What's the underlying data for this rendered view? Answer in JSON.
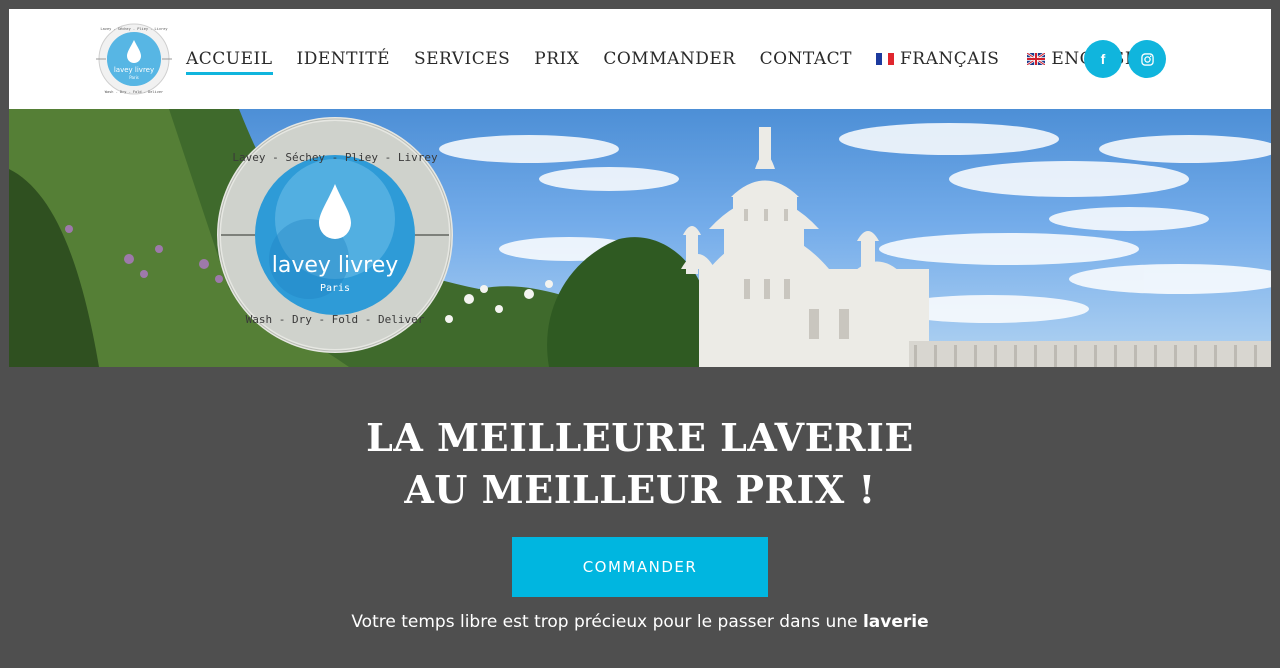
{
  "brand": {
    "logo_ring_top": "Lavey - Séchey - Pliey - Livrey",
    "logo_ring_bottom": "Wash - Dry - Fold - Deliver",
    "logo_name": "lavey livrey",
    "logo_city": "Paris"
  },
  "nav": {
    "items": [
      {
        "label": "ACCUEIL",
        "active": true
      },
      {
        "label": "IDENTITÉ"
      },
      {
        "label": "SERVICES"
      },
      {
        "label": "PRIX"
      },
      {
        "label": "COMMANDER"
      },
      {
        "label": "CONTACT"
      }
    ],
    "lang_fr": "FRANÇAIS",
    "lang_en": "ENGLISH"
  },
  "social": {
    "facebook_glyph": "f",
    "instagram_icon": "instagram-icon",
    "accent": "#10b5dd"
  },
  "hero": {
    "badge_top": "Lavey - Séchey - Pliey - Livrey",
    "badge_bottom": "Wash - Dry - Fold - Deliver",
    "badge_name": "lavey livrey",
    "badge_city": "Paris"
  },
  "main": {
    "headline_line1": "LA MEILLEURE LAVERIE",
    "headline_line2": "AU MEILLEUR PRIX !",
    "cta_label": "COMMANDER",
    "tagline_text": "Votre temps libre est trop précieux pour le passer dans une ",
    "tagline_bold": "laverie"
  },
  "colors": {
    "background": "#4f4f4f",
    "button": "#00b6e0"
  }
}
